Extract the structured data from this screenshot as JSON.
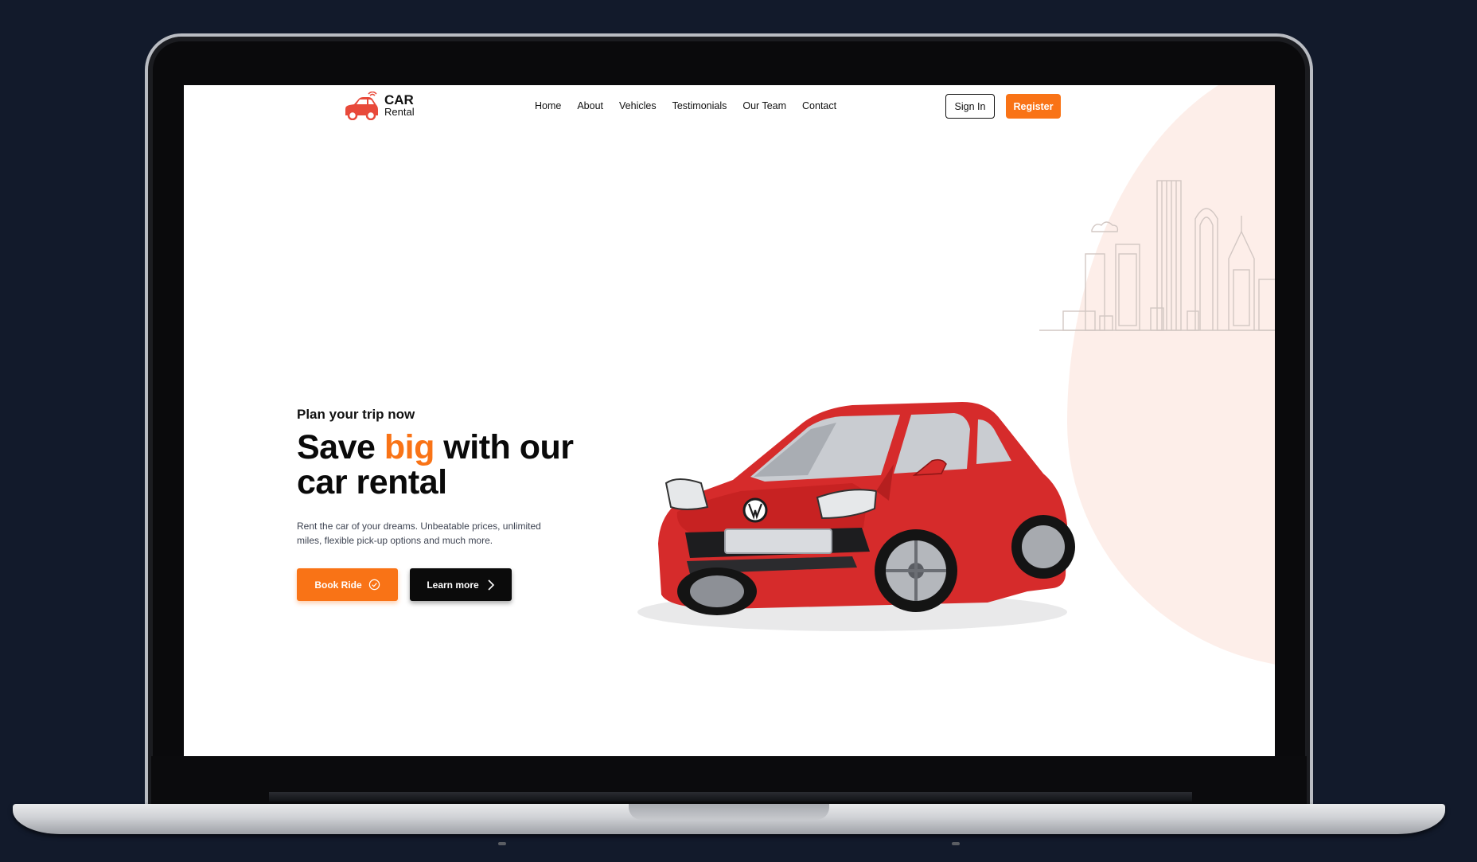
{
  "brand": {
    "title": "CAR",
    "subtitle": "Rental"
  },
  "nav": {
    "links": [
      "Home",
      "About",
      "Vehicles",
      "Testimonials",
      "Our Team",
      "Contact"
    ],
    "signin_label": "Sign In",
    "register_label": "Register"
  },
  "hero": {
    "eyebrow": "Plan your trip now",
    "headline_prefix": "Save ",
    "headline_accent": "big",
    "headline_suffix": " with our car rental",
    "description": "Rent the car of your dreams. Unbeatable prices, unlimited miles, flexible pick-up options and much more.",
    "book_label": "Book Ride",
    "learn_label": "Learn more"
  },
  "colors": {
    "accent": "#f97316",
    "background": "#121a2b",
    "blob": "#fdeee9",
    "car": "#d62b2b"
  },
  "icons": {
    "logo": "car-wifi-icon",
    "book": "check-circle-icon",
    "learn": "chevron-right-icon"
  }
}
